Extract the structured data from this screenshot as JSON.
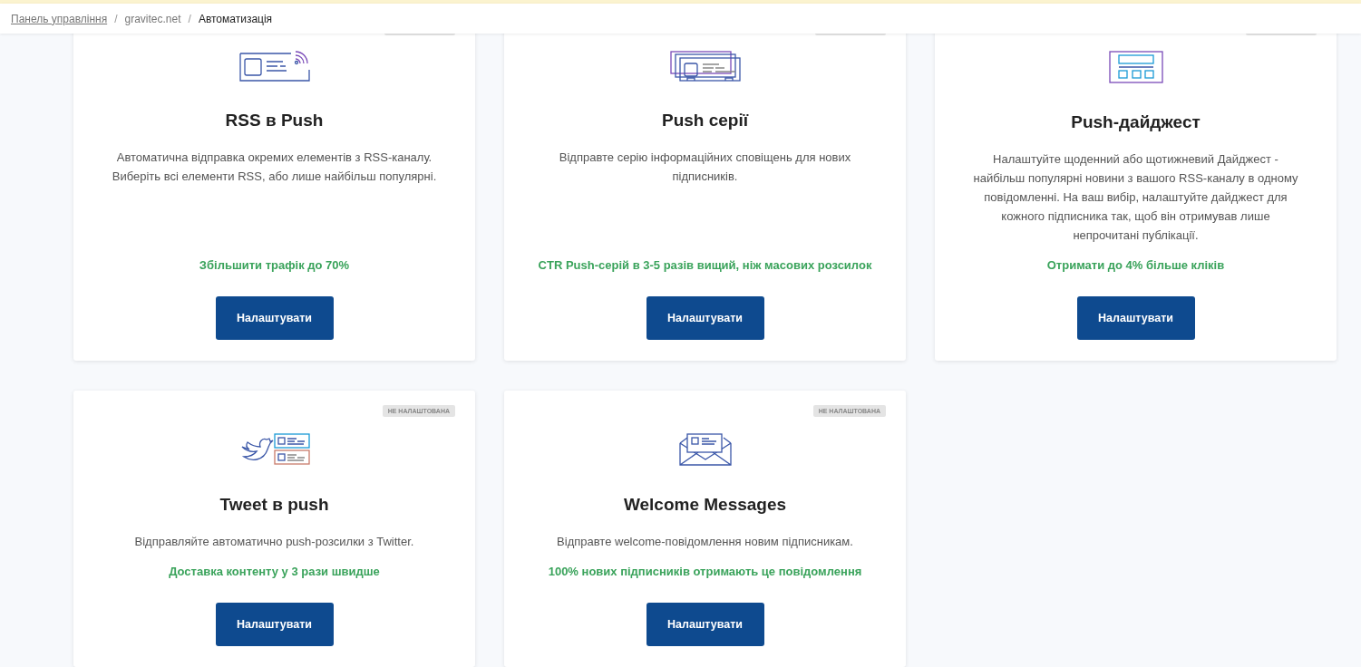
{
  "breadcrumbs": [
    {
      "label": "Панель управління",
      "kind": "link"
    },
    {
      "label": "/",
      "kind": "separator"
    },
    {
      "label": "gravitec.net",
      "kind": "link"
    },
    {
      "label": "/",
      "kind": "separator"
    },
    {
      "label": "Автоматизація",
      "kind": "current"
    }
  ],
  "cards": [
    {
      "kind": "rss",
      "title": "RSS в Push",
      "description": "Автоматична відправка окремих елементів з RSS-каналу. Виберіть всі елементи RSS, або лише найбільш популярні.",
      "highlight": "Збільшити трафік до 70%",
      "button": "Налаштувати",
      "badge_cut_off": true
    },
    {
      "kind": "series",
      "title": "Push серії",
      "description": "Відправте серію інформаційних сповіщень для нових підписників.",
      "highlight": "CTR Push-серій в 3-5 разів вищий, ніж масових розсилок",
      "button": "Налаштувати",
      "badge_cut_off": true
    },
    {
      "kind": "digest",
      "title": "Push-дайджест",
      "description": "Налаштуйте щоденний або щотижневий Дайджест - найбільш популярні новини з вашого RSS-каналу в одному повідомленні. На ваш вибір, налаштуйте дайджест для кожного підписника так, щоб він отримував лише непрочитані публікації.",
      "highlight": "Отримати до 4% більше кліків",
      "button": "Налаштувати",
      "badge_cut_off": true
    },
    {
      "kind": "tweet",
      "title": "Tweet в push",
      "description": "Відправляйте автоматично push-розсилки з Twitter.",
      "highlight": "Доставка контенту у 3 рази швидше",
      "button": "Налаштувати",
      "badge": "НЕ НАЛАШТОВАНА"
    },
    {
      "kind": "welcome",
      "title": "Welcome Messages",
      "description": "Відправте welcome-повідомлення новим підписникам.",
      "highlight": "100% нових підписників отримають це повідомлення",
      "button": "Налаштувати",
      "badge": "НЕ НАЛАШТОВАНА"
    }
  ]
}
